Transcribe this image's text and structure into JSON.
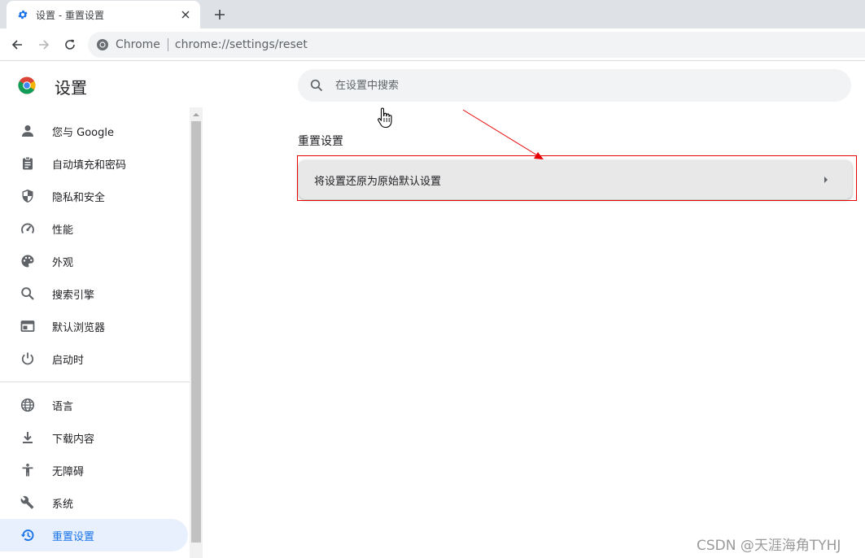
{
  "tab": {
    "title": "设置 - 重置设置"
  },
  "omnibox": {
    "site": "Chrome",
    "url": "chrome://settings/reset"
  },
  "settings": {
    "title": "设置"
  },
  "search": {
    "placeholder": "在设置中搜索"
  },
  "sidebar": {
    "items": [
      {
        "label": "您与 Google",
        "icon": "person-icon"
      },
      {
        "label": "自动填充和密码",
        "icon": "clipboard-icon"
      },
      {
        "label": "隐私和安全",
        "icon": "shield-icon"
      },
      {
        "label": "性能",
        "icon": "speedometer-icon"
      },
      {
        "label": "外观",
        "icon": "palette-icon"
      },
      {
        "label": "搜索引擎",
        "icon": "search-icon"
      },
      {
        "label": "默认浏览器",
        "icon": "browser-icon"
      },
      {
        "label": "启动时",
        "icon": "power-icon"
      },
      {
        "label": "语言",
        "icon": "globe-icon"
      },
      {
        "label": "下载内容",
        "icon": "download-icon"
      },
      {
        "label": "无障碍",
        "icon": "accessibility-icon"
      },
      {
        "label": "系统",
        "icon": "wrench-icon"
      },
      {
        "label": "重置设置",
        "icon": "restore-icon",
        "active": true
      }
    ]
  },
  "main": {
    "section_title": "重置设置",
    "card_label": "将设置还原为原始默认设置"
  },
  "colors": {
    "accent": "#1a73e8",
    "annotation": "#e60000"
  },
  "watermark": "CSDN @天涯海角TYHJ"
}
